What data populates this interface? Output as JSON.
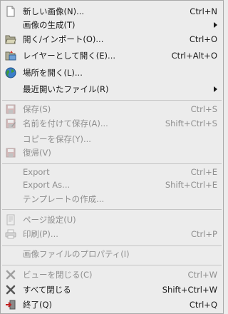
{
  "menu": {
    "items": [
      {
        "label": "新しい画像(N)...",
        "shortcut": "Ctrl+N"
      },
      {
        "label": "画像の生成(T)"
      },
      {
        "label": "開く/インポート(O)...",
        "shortcut": "Ctrl+O"
      },
      {
        "label": "レイヤーとして開く(E)...",
        "shortcut": "Ctrl+Alt+O"
      },
      {
        "label": "場所を開く(L)..."
      },
      {
        "label": "最近開いたファイル(R)"
      },
      {
        "label": "保存(S)",
        "shortcut": "Ctrl+S"
      },
      {
        "label": "名前を付けて保存(A)...",
        "shortcut": "Shift+Ctrl+S"
      },
      {
        "label": "コピーを保存(Y)..."
      },
      {
        "label": "復帰(V)"
      },
      {
        "label": "Export",
        "shortcut": "Ctrl+E"
      },
      {
        "label": "Export As...",
        "shortcut": "Shift+Ctrl+E"
      },
      {
        "label": "テンプレートの作成..."
      },
      {
        "label": "ページ設定(U)"
      },
      {
        "label": "印刷(P)...",
        "shortcut": "Ctrl+P"
      },
      {
        "label": "画像ファイルのプロパティ(I)"
      },
      {
        "label": "ビューを閉じる(C)",
        "shortcut": "Ctrl+W"
      },
      {
        "label": "すべて閉じる",
        "shortcut": "Shift+Ctrl+W"
      },
      {
        "label": "終了(Q)",
        "shortcut": "Ctrl+Q"
      }
    ]
  }
}
